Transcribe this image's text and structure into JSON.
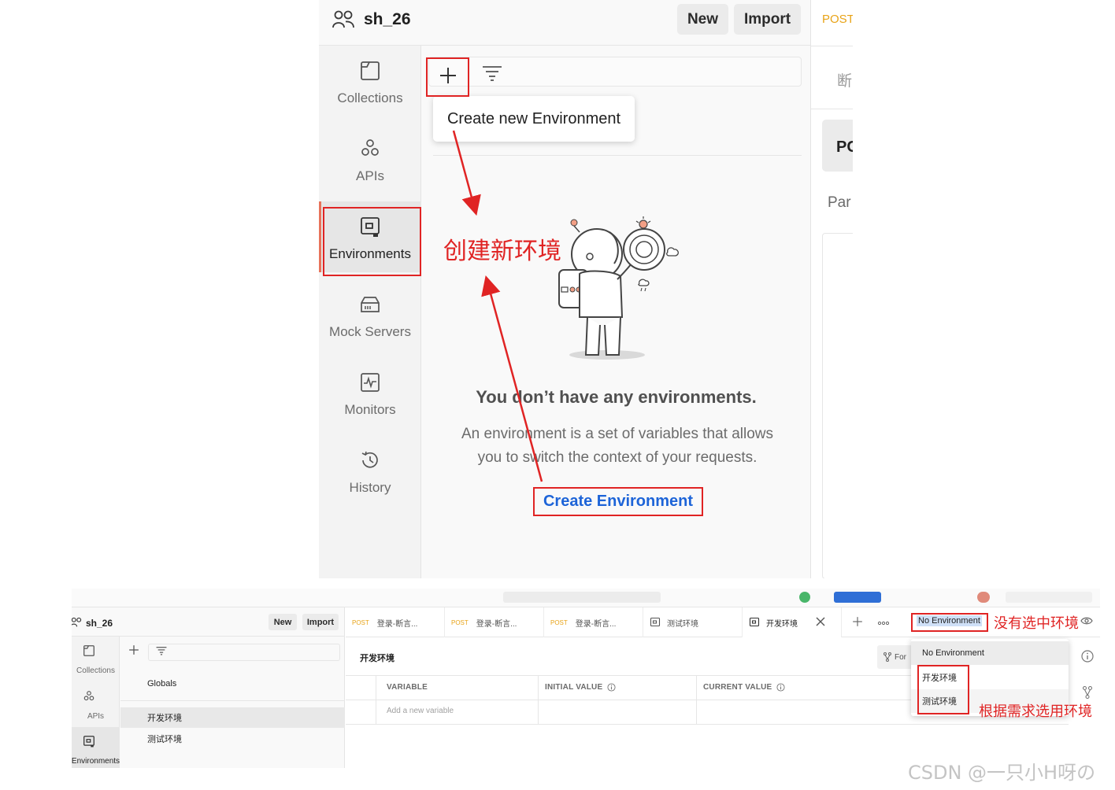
{
  "top": {
    "workspace": "sh_26",
    "header_buttons": {
      "new": "New",
      "import": "Import"
    },
    "sidebar": [
      {
        "label": "Collections",
        "icon": "collections-icon"
      },
      {
        "label": "APIs",
        "icon": "apis-icon"
      },
      {
        "label": "Environments",
        "icon": "environments-icon",
        "active": true
      },
      {
        "label": "Mock Servers",
        "icon": "mock-servers-icon"
      },
      {
        "label": "Monitors",
        "icon": "monitors-icon"
      },
      {
        "label": "History",
        "icon": "history-icon"
      }
    ],
    "tooltip": "Create new Environment",
    "empty_state": {
      "title": "You don’t have any environments.",
      "description_line1": "An environment is a set of variables that allows",
      "description_line2": "you to switch the context of your requests.",
      "button": "Create Environment"
    },
    "right_panel": {
      "method": "POST",
      "partial_text1": "断",
      "partial_text2": "PC",
      "partial_text3": "Par"
    }
  },
  "annotations": {
    "create_new_env": "创建新环境",
    "no_env_selected": "没有选中环境",
    "select_as_needed": "根据需求选用环境",
    "color": "#e02424"
  },
  "bottom": {
    "workspace": "sh_26",
    "header_buttons": {
      "new": "New",
      "import": "Import"
    },
    "sidebar": [
      {
        "label": "Collections",
        "icon": "collections-icon"
      },
      {
        "label": "APIs",
        "icon": "apis-icon"
      },
      {
        "label": "Environments",
        "icon": "environments-icon",
        "active": true
      }
    ],
    "list": {
      "globals": "Globals",
      "dev": "开发环境",
      "test": "测试环境"
    },
    "tabs": [
      {
        "method": "POST",
        "label": "登录-断言..."
      },
      {
        "method": "POST",
        "label": "登录-断言..."
      },
      {
        "method": "POST",
        "label": "登录-断言..."
      },
      {
        "method": "",
        "label": "测试环境"
      },
      {
        "method": "",
        "label": "开发环境",
        "active": true
      }
    ],
    "env_selector": "No Environment",
    "env_title": "开发环境",
    "fork_label": "For",
    "columns": {
      "variable": "VARIABLE",
      "initial": "INITIAL VALUE",
      "current": "CURRENT VALUE"
    },
    "add_variable_placeholder": "Add a new variable",
    "dropdown": {
      "none": "No Environment",
      "dev": "开发环境",
      "test": "测试环境"
    }
  },
  "watermark": "CSDN @一只小H呀の"
}
